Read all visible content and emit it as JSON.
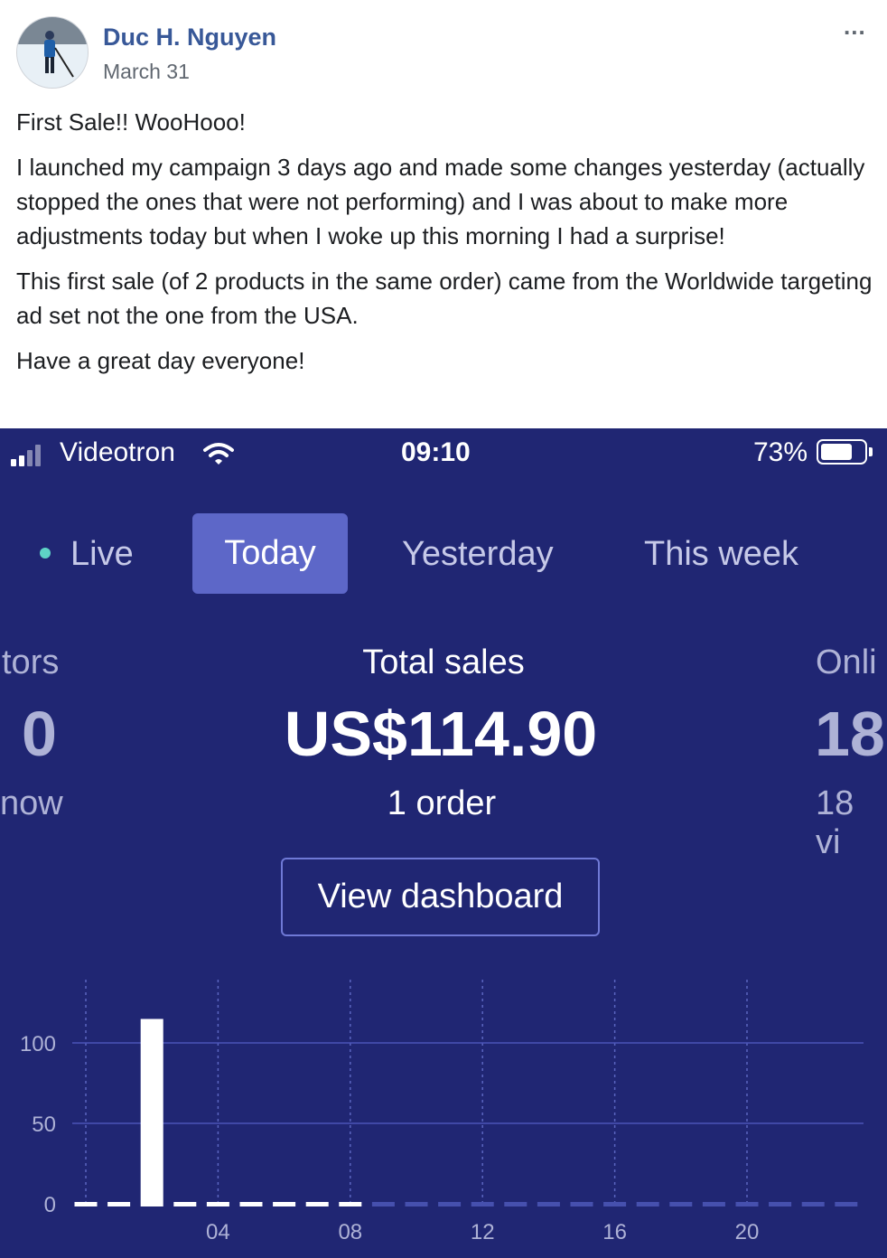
{
  "post": {
    "author": "Duc H. Nguyen",
    "date": "March 31",
    "paragraphs": [
      "First Sale!! WooHooo!",
      "I launched my campaign 3 days ago and made some changes yesterday (actually stopped the ones that were not performing) and I was about to make more adjustments today but when I woke up this morning I had a surprise!",
      "This first sale (of 2 products in the same order) came from the Worldwide targeting ad set not the one from the USA.",
      "Have a great day everyone!"
    ],
    "more_icon": "..."
  },
  "status_bar": {
    "carrier": "Videotron",
    "time": "09:10",
    "battery": "73%",
    "battery_level": 0.73,
    "icons": [
      "signal-icon",
      "wifi-icon",
      "battery-icon"
    ]
  },
  "tabs": [
    {
      "label": "Live",
      "selected": false
    },
    {
      "label": "Today",
      "selected": true
    },
    {
      "label": "Yesterday",
      "selected": false
    },
    {
      "label": "This week",
      "selected": false
    }
  ],
  "stats": {
    "left": {
      "title": "tors",
      "value": "0",
      "sub": "now"
    },
    "center": {
      "title": "Total sales",
      "value": "US$114.90",
      "sub": "1 order"
    },
    "right": {
      "title": "Onli",
      "value": "18",
      "sub": "18 vi"
    }
  },
  "view_dashboard_label": "View dashboard",
  "colors": {
    "background": "#202673",
    "selected_tab": "#5d67c8",
    "live_dot": "#5ed3c6",
    "link": "#385898",
    "bars": "#ffffff",
    "gridline": "#4a54b8"
  },
  "chart_data": {
    "type": "bar",
    "x": [
      0,
      1,
      2,
      3,
      4,
      5,
      6,
      7,
      8,
      9,
      10,
      11,
      12,
      13,
      14,
      15,
      16,
      17,
      18,
      19,
      20,
      21,
      22,
      23
    ],
    "values": [
      0,
      0,
      114.9,
      0,
      0,
      0,
      0,
      0,
      0,
      0,
      0,
      0,
      0,
      0,
      0,
      0,
      0,
      0,
      0,
      0,
      0,
      0,
      0,
      0
    ],
    "elapsed_hours": 9,
    "xtick_labels": [
      "04",
      "08",
      "12",
      "16",
      "20"
    ],
    "xtick_hours": [
      4,
      8,
      12,
      16,
      20
    ],
    "yticks": [
      0,
      50,
      100
    ],
    "ylim": [
      0,
      125
    ],
    "grid": true
  }
}
